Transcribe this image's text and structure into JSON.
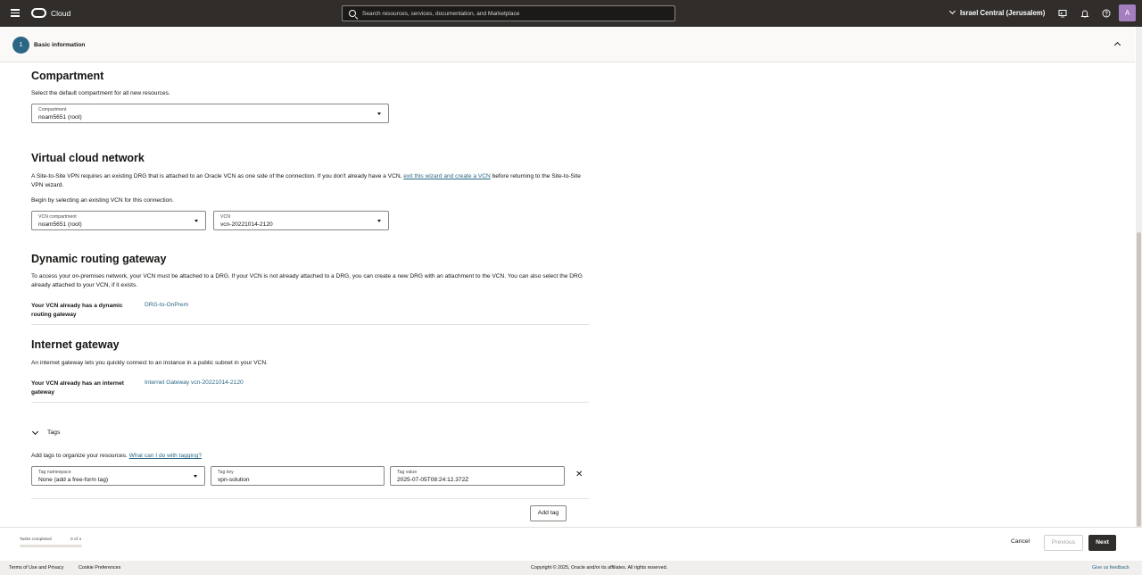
{
  "topbar": {
    "brand": "Cloud",
    "search_placeholder": "Search resources, services, documentation, and Marketplace",
    "region": "Israel Central (Jerusalem)",
    "avatar": "A"
  },
  "step": {
    "number": "1",
    "label": "Basic information"
  },
  "compartment": {
    "title": "Compartment",
    "description": "Select the default compartment for all new resources.",
    "select_label": "Compartment",
    "select_value": "noam5651 (root)"
  },
  "vcn": {
    "title": "Virtual cloud network",
    "desc_pre": "A Site-to-Site VPN requires an existing DRG that is attached to an Oracle VCN as one side of the connection. If you don't already have a VCN,",
    "desc_link": "exit this wizard and create a VCN",
    "desc_post": "before returning to the Site-to-Site VPN wizard.",
    "begin_text": "Begin by selecting an existing VCN for this connection.",
    "compartment_label": "VCN compartment",
    "compartment_value": "noam5651 (root)",
    "vcn_label": "VCN",
    "vcn_value": "vcn-20221014-2120"
  },
  "drg": {
    "title": "Dynamic routing gateway",
    "description": "To access your on-premises network, your VCN must be attached to a DRG. If your VCN is not already attached to a DRG, you can create a new DRG with an attachment to the VCN. You can also select the DRG already attached to your VCN, if it exists.",
    "row_label": "Your VCN already has a dynamic routing gateway",
    "row_value": "DRG-to-OnPrem"
  },
  "igw": {
    "title": "Internet gateway",
    "description": "An internet gateway lets you quickly connect to an instance in a public subnet in your VCN.",
    "row_label": "Your VCN already has an internet gateway",
    "row_value": "Internet Gateway vcn-20221014-2120"
  },
  "tags": {
    "title": "Tags",
    "description": "Add tags to organize your resources.",
    "help_link": "What can I do with tagging?",
    "namespace_label": "Tag namespace",
    "namespace_value": "None (add a free-form tag)",
    "key_label": "Tag key",
    "key_value": "vpn-solution",
    "value_label": "Tag value",
    "value_value": "2025-07-05T08:24:12.372Z",
    "add_button": "Add tag"
  },
  "footer": {
    "tasks_label": "Tasks completed",
    "tasks_count": "0 of 4",
    "progress_fraction": 0,
    "cancel": "Cancel",
    "previous": "Previous",
    "next": "Next"
  },
  "bottom": {
    "terms": "Terms of Use and Privacy",
    "cookies": "Cookie Preferences",
    "copyright": "Copyright © 2025, Oracle and/or its affiliates. All rights reserved.",
    "feedback": "Give us feedback"
  }
}
